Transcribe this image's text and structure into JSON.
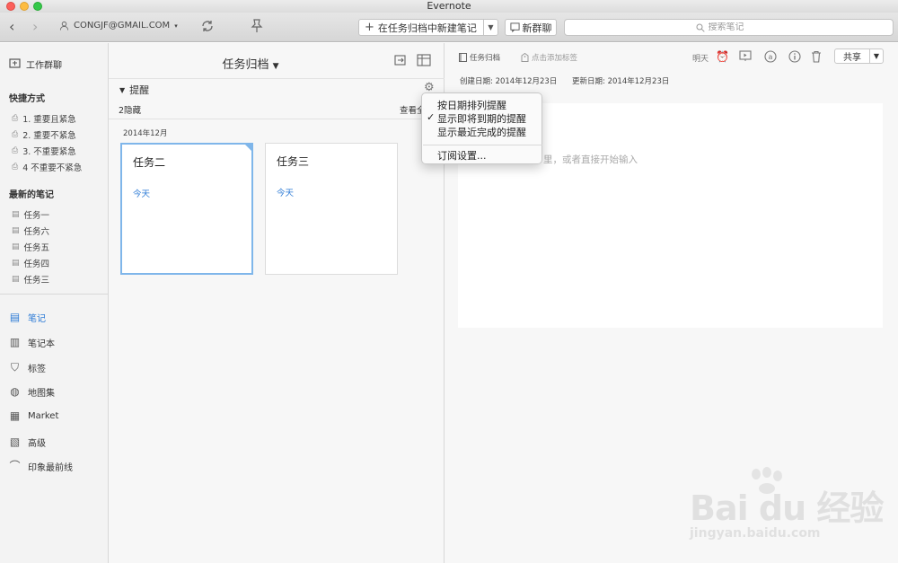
{
  "window": {
    "title": "Evernote"
  },
  "toolbar": {
    "back": "‹",
    "forward": "›",
    "account": "CONGJF@GMAIL.COM",
    "new_note_label": "在任务归档中新建笔记",
    "work_chat_label": "新群聊",
    "search_placeholder": "搜索笔记"
  },
  "sidebar": {
    "work_chat": "工作群聊",
    "shortcuts_heading": "快捷方式",
    "shortcuts": [
      "1. 重要且紧急",
      "2. 重要不紧急",
      "3. 不重要紧急",
      "4 不重要不紧急"
    ],
    "recent_heading": "最新的笔记",
    "recent": [
      "任务一",
      "任务六",
      "任务五",
      "任务四",
      "任务三"
    ],
    "main": [
      "笔记",
      "笔记本",
      "标签",
      "地图集",
      "Market",
      "高级",
      "印象最前线"
    ]
  },
  "notelist": {
    "title": "任务归档",
    "reminders_title": "提醒",
    "hidden_count": "2隐藏",
    "view_all": "查看全",
    "month": "2014年12月",
    "cards": [
      {
        "title": "任务二",
        "date": "今天"
      },
      {
        "title": "任务三",
        "date": "今天"
      }
    ]
  },
  "menu": {
    "items": [
      "按日期排列提醒",
      "显示即将到期的提醒",
      "显示最近完成的提醒",
      "订阅设置..."
    ],
    "checked": "✓"
  },
  "editor": {
    "notebook": "任务归档",
    "tag_placeholder": "点击添加标签",
    "created": "创建日期: 2014年12月23日",
    "updated": "更新日期: 2014年12月23日",
    "body_placeholder": "里，或者直接开始输入",
    "toolbar_label": "明天",
    "share": "共享"
  },
  "watermark": {
    "brand": "Bai du 经验",
    "url": "jingyan.baidu.com"
  }
}
